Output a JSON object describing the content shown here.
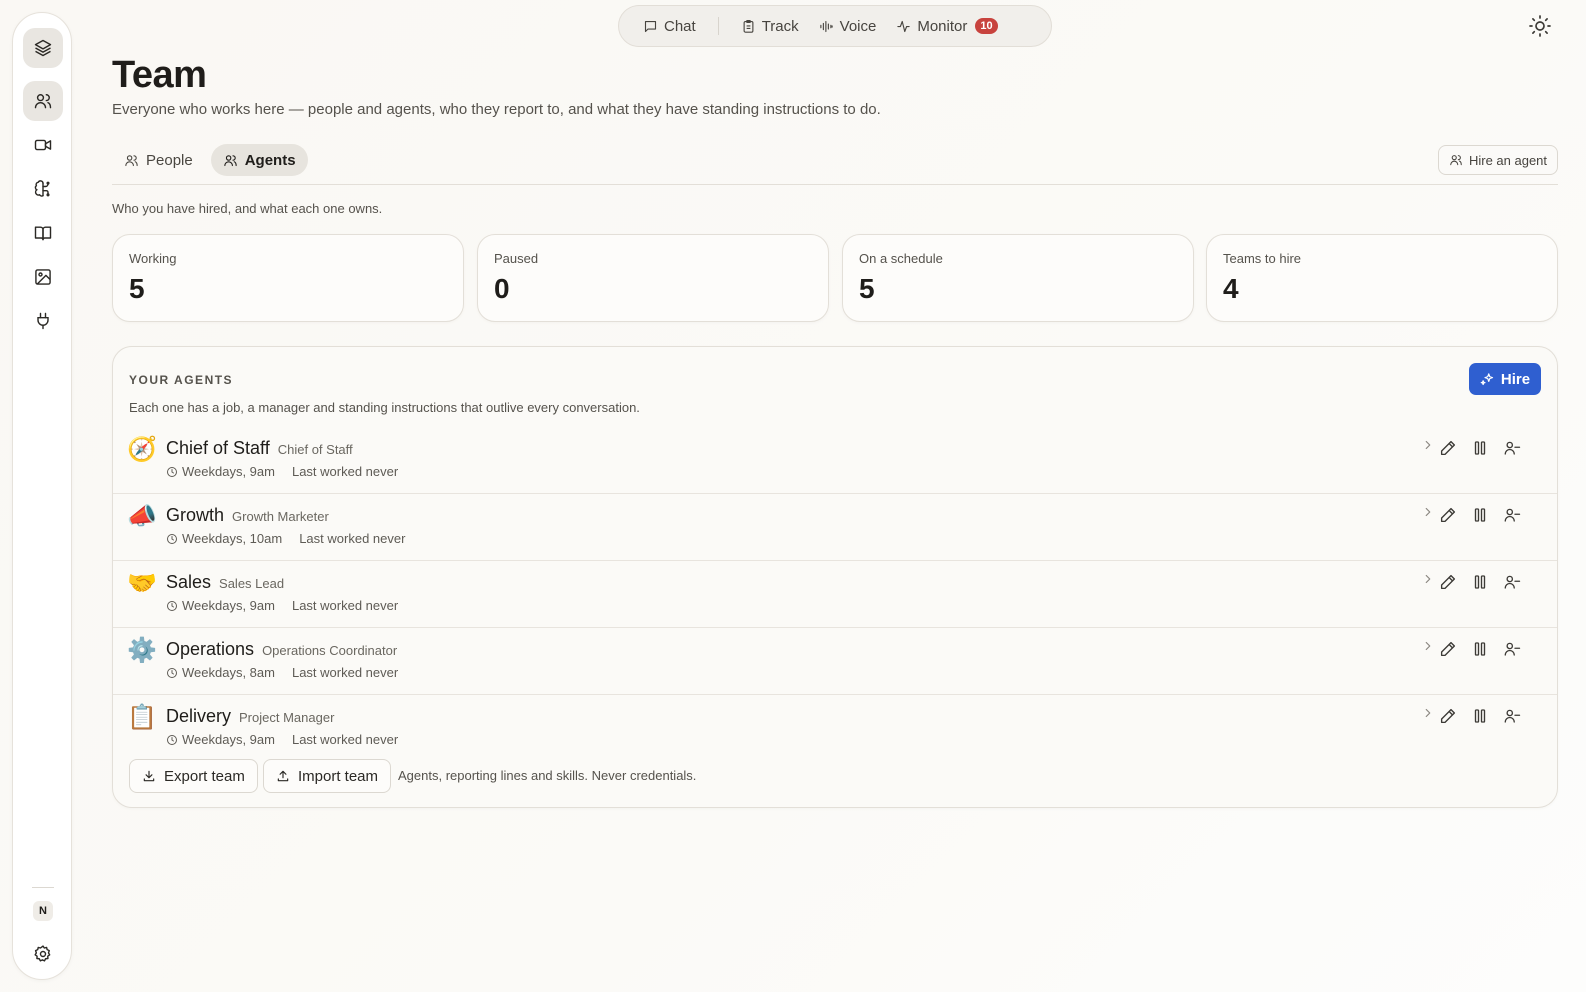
{
  "sidebar": {
    "items": [
      {
        "icon": "layers-icon"
      },
      {
        "icon": "team-icon"
      },
      {
        "icon": "video-icon"
      },
      {
        "icon": "brain-icon"
      },
      {
        "icon": "book-icon"
      },
      {
        "icon": "image-icon"
      },
      {
        "icon": "plug-icon"
      }
    ],
    "avatar_initial": "N"
  },
  "topnav": {
    "chat": "Chat",
    "track": "Track",
    "voice": "Voice",
    "monitor": "Monitor",
    "monitor_badge": "10"
  },
  "header": {
    "title": "Team",
    "subtitle": "Everyone who works here — people and agents, who they report to, and what they have standing instructions to do."
  },
  "tabs": {
    "people": "People",
    "agents": "Agents",
    "active": "Agents"
  },
  "hire_agent_label": "Hire an agent",
  "section_note": "Who you have hired, and what each one owns.",
  "stats": [
    {
      "label": "Working",
      "value": "5"
    },
    {
      "label": "Paused",
      "value": "0"
    },
    {
      "label": "On a schedule",
      "value": "5"
    },
    {
      "label": "Teams to hire",
      "value": "4"
    }
  ],
  "agents_panel": {
    "eyebrow": "YOUR AGENTS",
    "description": "Each one has a job, a manager and standing instructions that outlive every conversation.",
    "hire_label": "Hire",
    "agents": [
      {
        "emoji": "🧭",
        "name": "Chief of Staff",
        "role": "Chief of Staff",
        "schedule": "Weekdays, 9am",
        "last_worked": "Last worked never"
      },
      {
        "emoji": "📣",
        "name": "Growth",
        "role": "Growth Marketer",
        "schedule": "Weekdays, 10am",
        "last_worked": "Last worked never"
      },
      {
        "emoji": "🤝",
        "name": "Sales",
        "role": "Sales Lead",
        "schedule": "Weekdays, 9am",
        "last_worked": "Last worked never"
      },
      {
        "emoji": "⚙️",
        "name": "Operations",
        "role": "Operations Coordinator",
        "schedule": "Weekdays, 8am",
        "last_worked": "Last worked never"
      },
      {
        "emoji": "📋",
        "name": "Delivery",
        "role": "Project Manager",
        "schedule": "Weekdays, 9am",
        "last_worked": "Last worked never"
      }
    ],
    "export_label": "Export team",
    "import_label": "Import team",
    "footer_note": "Agents, reporting lines and skills. Never credentials."
  },
  "colors": {
    "accent": "#2f5fd0",
    "badge": "#c8433e"
  }
}
